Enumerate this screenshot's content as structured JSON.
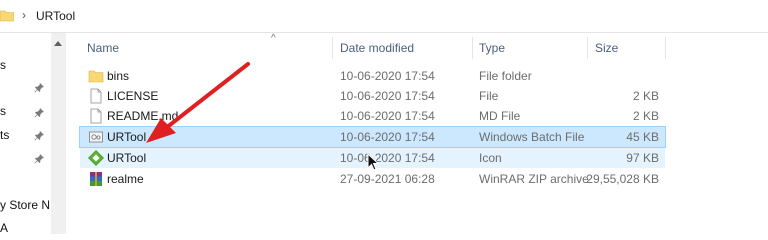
{
  "address": {
    "path": "URTool"
  },
  "nav": {
    "items": [
      "s",
      "s",
      "ts",
      "y Store N",
      "A"
    ]
  },
  "columns": {
    "name": "Name",
    "date": "Date modified",
    "type": "Type",
    "size": "Size"
  },
  "files": [
    {
      "icon": "folder-icon",
      "name": "bins",
      "date": "10-06-2020 17:54",
      "type": "File folder",
      "size": ""
    },
    {
      "icon": "file-icon",
      "name": "LICENSE",
      "date": "10-06-2020 17:54",
      "type": "File",
      "size": "2 KB"
    },
    {
      "icon": "file-icon",
      "name": "README.md",
      "date": "10-06-2020 17:54",
      "type": "MD File",
      "size": "2 KB"
    },
    {
      "icon": "batch-file-icon",
      "name": "URTool",
      "date": "10-06-2020 17:54",
      "type": "Windows Batch File",
      "size": "45 KB"
    },
    {
      "icon": "app-diamond-icon",
      "name": "URTool",
      "date": "10-06-2020 17:54",
      "type": "Icon",
      "size": "97 KB"
    },
    {
      "icon": "winrar-icon",
      "name": "realme",
      "date": "27-09-2021 06:28",
      "type": "WinRAR ZIP archive",
      "size": "29,55,028 KB"
    }
  ],
  "colors": {
    "selection": "#cce8ff",
    "hover": "#e5f3ff",
    "arrow": "#e02020",
    "header_text": "#4c607a"
  }
}
